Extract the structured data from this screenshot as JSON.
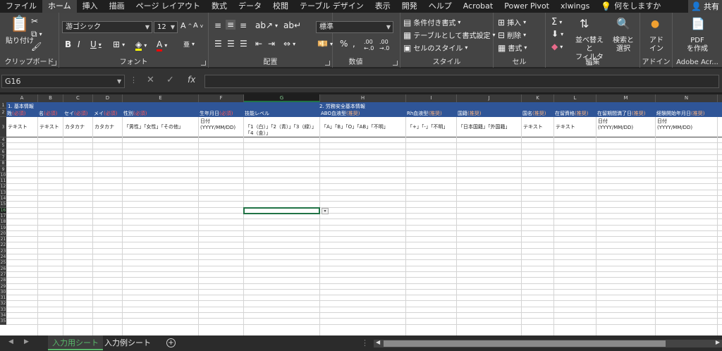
{
  "tabs": [
    "ファイル",
    "ホーム",
    "挿入",
    "描画",
    "ページ レイアウト",
    "数式",
    "データ",
    "校閲",
    "テーブル デザイン",
    "表示",
    "開発",
    "ヘルプ",
    "Acrobat",
    "Power Pivot",
    "xlwings"
  ],
  "active_tab": "ホーム",
  "search_text": "何をしますか",
  "share_label": "共有",
  "ribbon": {
    "clipboard": {
      "paste": "貼り付け",
      "label": "クリップボード"
    },
    "font": {
      "name": "游ゴシック",
      "size": "12",
      "label": "フォント"
    },
    "alignment": {
      "label": "配置"
    },
    "number": {
      "format": "標準",
      "label": "数値"
    },
    "styles": {
      "conditional": "条件付き書式",
      "table": "テーブルとして書式設定",
      "cell_style": "セルのスタイル",
      "label": "スタイル"
    },
    "cells": {
      "insert": "挿入",
      "delete": "削除",
      "format": "書式",
      "label": "セル"
    },
    "editing": {
      "sort_line1": "並べ替えと",
      "sort_line2": "フィルター",
      "find_line1": "検索と",
      "find_line2": "選択",
      "label": "編集"
    },
    "addin": {
      "line1": "アド",
      "line2": "イン",
      "label": "アドイン"
    },
    "adobe": {
      "line1": "PDF",
      "line2": "を作成",
      "label": "Adobe Acr..."
    }
  },
  "formula_bar": {
    "name_box": "G16",
    "fx": "fx",
    "value": ""
  },
  "columns": [
    "A",
    "B",
    "C",
    "D",
    "E",
    "F",
    "G",
    "H",
    "I",
    "J",
    "K",
    "L",
    "M",
    "N"
  ],
  "selected_column": "G",
  "rows": [
    "1",
    "2",
    "3",
    "4",
    "5",
    "6",
    "7",
    "8",
    "9",
    "10",
    "11",
    "12",
    "13",
    "14",
    "15",
    "16",
    "17",
    "18",
    "19",
    "20",
    "21",
    "22",
    "23",
    "24",
    "25",
    "26",
    "27",
    "28",
    "29",
    "30",
    "31",
    "32",
    "33",
    "34",
    "35"
  ],
  "selected_row": "16",
  "sheet": {
    "section1": "1. 基本情報",
    "section2": "2. 労務安全基本情報",
    "headers": [
      {
        "text": "姓",
        "tag": "(必須)",
        "kind": "req"
      },
      {
        "text": "名",
        "tag": "(必須)",
        "kind": "req"
      },
      {
        "text": "セイ",
        "tag": "(必須)",
        "kind": "req"
      },
      {
        "text": "メイ",
        "tag": "(必須)",
        "kind": "req"
      },
      {
        "text": "性別",
        "tag": "(必須)",
        "kind": "req"
      },
      {
        "text": "生年月日",
        "tag": "(必須)",
        "kind": "req"
      },
      {
        "text": "技能レベル",
        "tag": "",
        "kind": ""
      },
      {
        "text": "ABO血液型",
        "tag": "(推奨)",
        "kind": "rec"
      },
      {
        "text": "Rh血液型",
        "tag": "(推奨)",
        "kind": "rec"
      },
      {
        "text": "国籍",
        "tag": "(推奨)",
        "kind": "rec"
      },
      {
        "text": "国名",
        "tag": "(推奨)",
        "kind": "rec"
      },
      {
        "text": "在留資格",
        "tag": "(推奨)",
        "kind": "rec"
      },
      {
        "text": "在留期間満了日",
        "tag": "(推奨)",
        "kind": "rec"
      },
      {
        "text": "経験開始年月日",
        "tag": "(推奨)",
        "kind": "rec"
      }
    ],
    "descriptions": [
      "テキスト",
      "テキスト",
      "カタカナ",
      "カタカナ",
      "「男性」「女性」「その他」",
      "日付\n(YYYY/MM/DD)",
      "「1（白）」「2（青）」「3（緑）」「4（金）」",
      "「A」「B」「O」「AB」「不明」",
      "「+」「-」「不明」",
      "「日本国籍」「外国籍」",
      "テキスト",
      "テキスト",
      "日付\n(YYYY/MM/DD)",
      "日付\n(YYYY/MM/DD)"
    ]
  },
  "sheet_tabs": [
    "入力用シート",
    "入力例シート"
  ],
  "active_sheet": "入力用シート"
}
